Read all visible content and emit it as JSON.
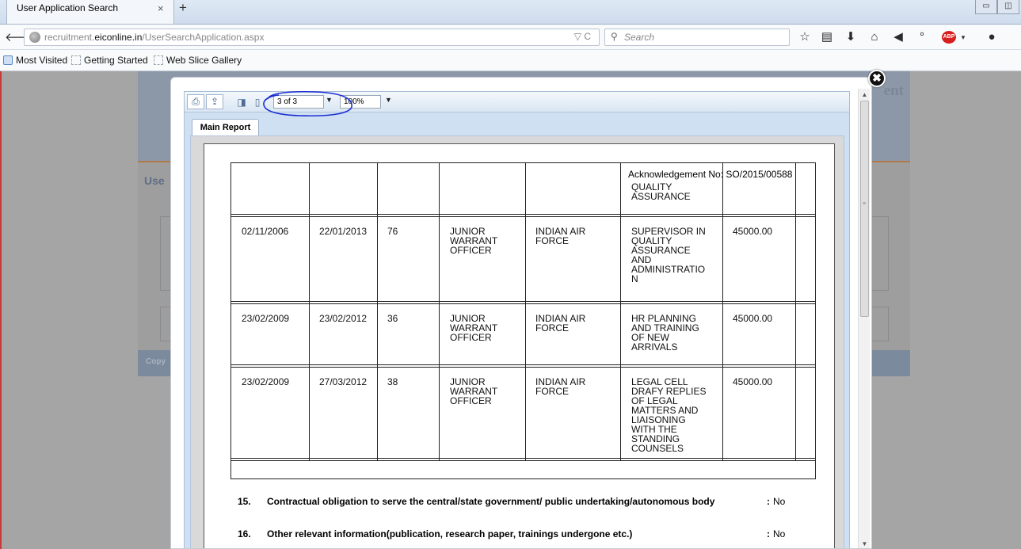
{
  "browser": {
    "tab_title": "User Application Search",
    "tab_close": "×",
    "new_tab": "+",
    "url_prefix": "recruitment.",
    "url_domain": "eiconline.in",
    "url_path": "/UserSearchApplication.aspx",
    "url_icons": "▽ C",
    "search_placeholder": "Search",
    "bookmarks": [
      "Most Visited",
      "Getting Started",
      "Web Slice Gallery"
    ],
    "toolbar_icons": [
      "star-icon",
      "bookmarks-list-icon",
      "download-icon",
      "home-icon",
      "send-icon",
      "extension-icon",
      "adblock-icon",
      "chat-icon"
    ],
    "abp_label": "ABP"
  },
  "site": {
    "title_fragment": "ent",
    "user_label": "Use",
    "footer_fragment": "Copy"
  },
  "viewer": {
    "page_selector": "3 of 3",
    "zoom": "100%",
    "tab_label": "Main Report",
    "annotation_color": "#1b2fd1"
  },
  "report": {
    "acknowledgement": "Acknowledgement No: SO/2015/00588",
    "continued_cell": "QUALITY\nASSURANCE",
    "rows": [
      {
        "from": "02/11/2006",
        "to": "22/01/2013",
        "months": "76",
        "post": "JUNIOR\nWARRANT\nOFFICER",
        "organisation": "INDIAN AIR\nFORCE",
        "duties": "SUPERVISOR IN\nQUALITY\nASSURANCE\nAND\nADMINISTRATIO\nN",
        "pay": "45000.00"
      },
      {
        "from": "23/02/2009",
        "to": "23/02/2012",
        "months": "36",
        "post": "JUNIOR\nWARRANT\nOFFICER",
        "organisation": "INDIAN AIR\nFORCE",
        "duties": "HR PLANNING\nAND TRAINING\nOF NEW\nARRIVALS",
        "pay": "45000.00"
      },
      {
        "from": "23/02/2009",
        "to": "27/03/2012",
        "months": "38",
        "post": "JUNIOR\nWARRANT\nOFFICER",
        "organisation": "INDIAN AIR\nFORCE",
        "duties": "LEGAL CELL\nDRAFY REPLIES\nOF LEGAL\nMATTERS AND\nLIAISONING\nWITH THE\nSTANDING\nCOUNSELS",
        "pay": "45000.00"
      }
    ],
    "questions": [
      {
        "number": "15.",
        "text": "Contractual obligation to serve the central/state government/ public undertaking/autonomous body",
        "colon": ":",
        "answer": "No"
      },
      {
        "number": "16.",
        "text": "Other relevant information(publication, research paper, trainings undergone etc.)",
        "colon": ":",
        "answer": "No"
      }
    ]
  }
}
